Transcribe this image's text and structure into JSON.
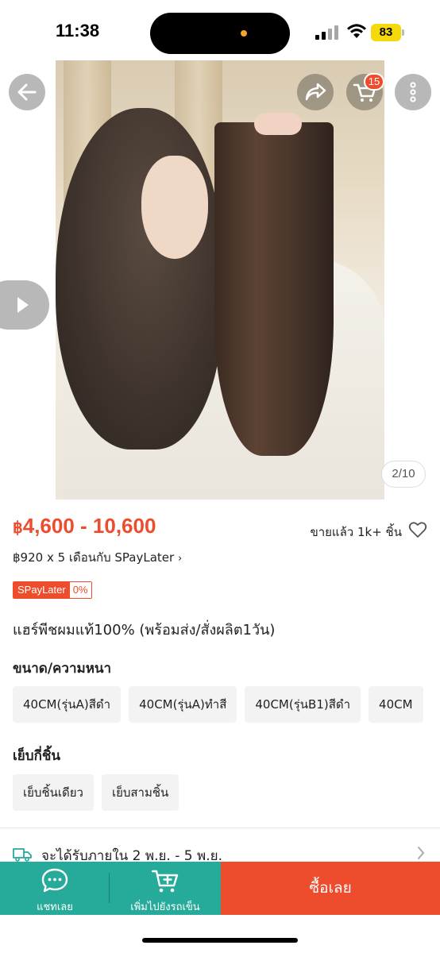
{
  "status_bar": {
    "time": "11:38",
    "battery": "83"
  },
  "product_gallery": {
    "cart_count": "15",
    "image_counter": "2/10",
    "icons": [
      "back-arrow-icon",
      "share-icon",
      "cart-icon",
      "more-vertical-icon",
      "play-icon"
    ]
  },
  "price": {
    "currency": "฿",
    "range": "4,600 - 10,600",
    "sold": "ขายแล้ว 1k+ ชิ้น",
    "installment": "฿920 x 5 เดือนกับ SPayLater",
    "badge_label": "SPayLater",
    "badge_value": "0%"
  },
  "product": {
    "title": "แฮร์พีชผมแท้100% (พร้อมส่ง/สั่งผลิต1วัน)"
  },
  "variations": {
    "size_label": "ขนาด/ความหนา",
    "size_options": [
      "40CM(รุ่นA)สีดำ",
      "40CM(รุ่นA)ทำสี",
      "40CM(รุ่นB1)สีดำ",
      "40CM"
    ],
    "clip_label": "เย็บกี่ชิ้น",
    "clip_options": [
      "เย็บชิ้นเดียว",
      "เย็บสามชิ้น"
    ]
  },
  "delivery": {
    "text": "จะได้รับภายใน 2 พ.ย. - 5 พ.ย."
  },
  "bottom_bar": {
    "chat_label": "แชทเลย",
    "add_to_cart_label": "เพิ่มไปยังรถเข็น",
    "buy_label": "ซื้อเลย"
  },
  "colors": {
    "accent": "#ee4d2d",
    "teal": "#26aa99"
  }
}
